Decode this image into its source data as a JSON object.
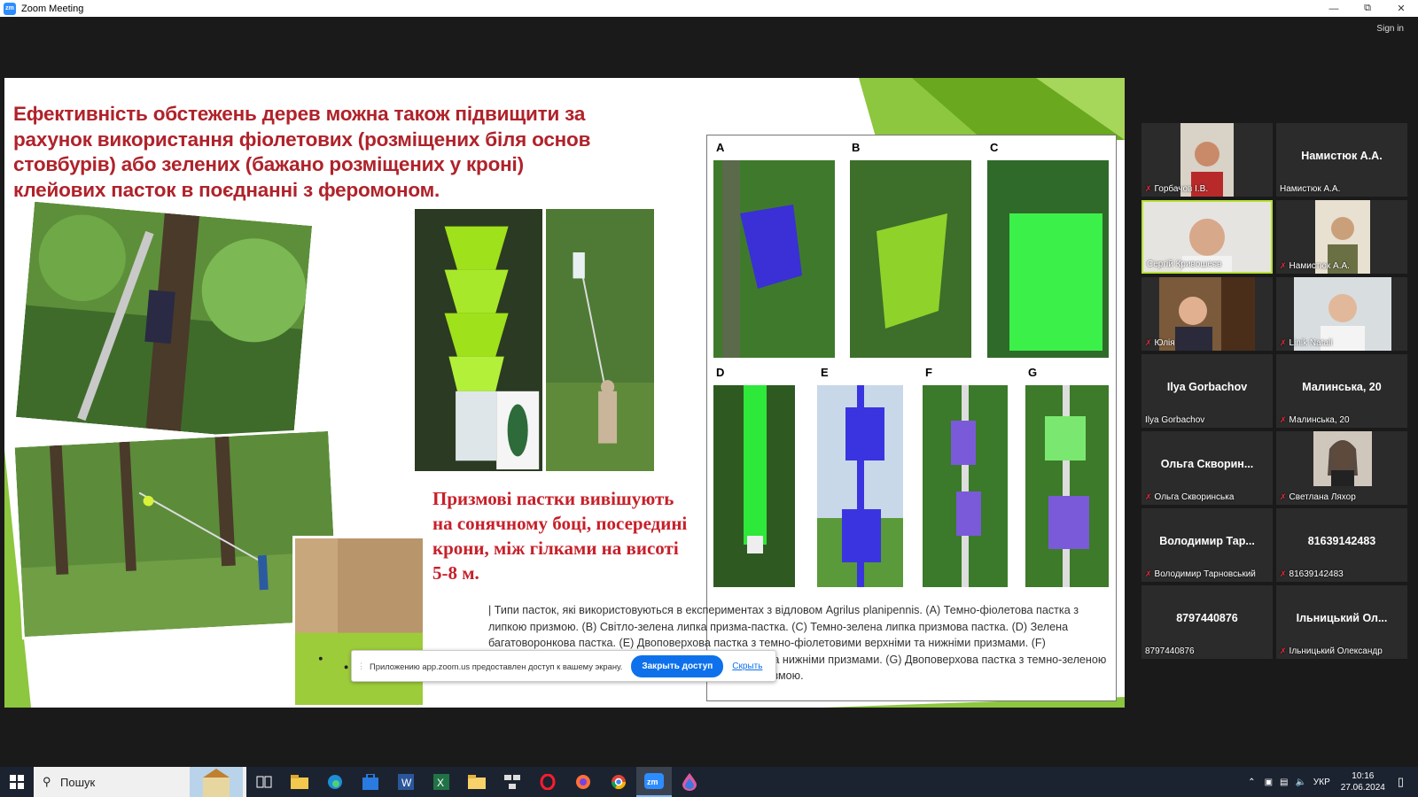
{
  "window": {
    "title": "Zoom Meeting",
    "app_icon": "zm",
    "controls": [
      "minimize-icon",
      "restore-icon",
      "close-icon"
    ]
  },
  "meeting": {
    "sign_in": "Sign in"
  },
  "slide": {
    "heading": "Ефективність обстежень дерев можна також підвищити за рахунок використання фіолетових (розміщених біля основ стовбурів) або зелених (бажано розміщених у кроні) клейових пасток в поєднанні з феромоном.",
    "prism_text": "Призмові пастки вивішують на сонячному боці, посередині крони, між гілками на висоті 5-8 м.",
    "figure_letters": [
      "A",
      "B",
      "C",
      "D",
      "E",
      "F",
      "G"
    ],
    "caption": "| Типи пасток, які використовуються в експериментах з відловом Agrilus planipennis. (A) Темно-фіолетова пастка з липкою призмою. (B) Світло-зелена липка призма-пастка. (C) Темно-зелена липка призмова пастка. (D) Зелена багатоворонкова пастка. (E) Двоповерхова пастка з темно-фіолетовими верхніми та нижніми призмами. (F) Двоповерхова пастка зі світло-фіолетовими верхніми та нижніми призмами. (G) Двоповерхова пастка з темно-зеленою верхньою призмою та світло-фіолетовою нижньою призмою."
  },
  "share_notice": {
    "message": "Приложению app.zoom.us предоставлен доступ к вашему экрану.",
    "stop_button": "Закрыть доступ",
    "hide_link": "Скрыть"
  },
  "participants": [
    {
      "display": "",
      "name": "Горбачов І.В.",
      "muted": true,
      "video": true
    },
    {
      "display": "Намистюк А.А.",
      "name": "Намистюк А.А.",
      "muted": false,
      "video": false
    },
    {
      "display": "",
      "name": "Сергій Кривошеєв",
      "muted": false,
      "video": true,
      "active_speaker": true
    },
    {
      "display": "",
      "name": "Намистюк А.А.",
      "muted": true,
      "video": true
    },
    {
      "display": "",
      "name": "Юлія",
      "muted": true,
      "video": true
    },
    {
      "display": "",
      "name": "Linik Natali",
      "muted": true,
      "video": true
    },
    {
      "display": "Ilya Gorbachov",
      "name": "Ilya Gorbachov",
      "muted": false,
      "video": false
    },
    {
      "display": "Малинська, 20",
      "name": "Малинська, 20",
      "muted": true,
      "video": false
    },
    {
      "display": "Ольга Скворин...",
      "name": "Ольга Скворинська",
      "muted": true,
      "video": false
    },
    {
      "display": "",
      "name": "Светлана Ляхор",
      "muted": true,
      "video": true
    },
    {
      "display": "Володимир Тар...",
      "name": "Володимир Тарновський",
      "muted": true,
      "video": false
    },
    {
      "display": "81639142483",
      "name": "81639142483",
      "muted": true,
      "video": false
    },
    {
      "display": "8797440876",
      "name": "8797440876",
      "muted": false,
      "video": false
    },
    {
      "display": "Ільницький Ол...",
      "name": "Ільницький Олександр",
      "muted": true,
      "video": false
    }
  ],
  "taskbar": {
    "search_placeholder": "Пошук",
    "apps": [
      "task-view-icon",
      "file-explorer-icon",
      "edge-icon",
      "store-icon",
      "word-icon",
      "excel-icon",
      "folder-icon",
      "network-app-icon",
      "opera-icon",
      "firefox-icon",
      "chrome-icon",
      "zoom-icon",
      "droplet-app-icon"
    ],
    "language": "УКР",
    "time": "10:16",
    "date": "27.06.2024"
  }
}
